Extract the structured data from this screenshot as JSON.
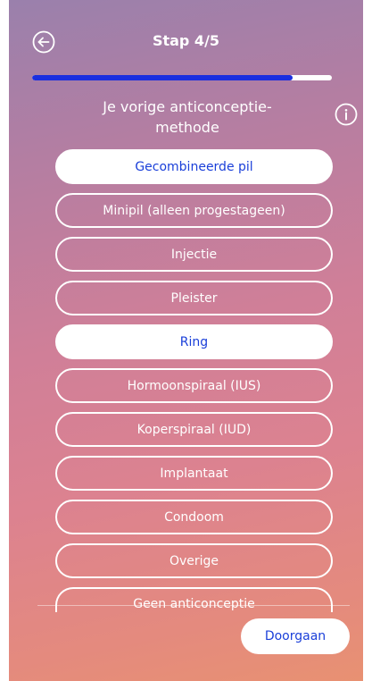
{
  "header": {
    "title": "Stap 4/5",
    "back_icon": "back-arrow-circle-icon"
  },
  "progress": {
    "fraction": 0.87,
    "fill_color": "#1a2ee0"
  },
  "question": {
    "text": "Je vorige anticonceptie-methode",
    "info_icon": "info-circle-icon"
  },
  "options": [
    {
      "label": "Gecombineerde pil",
      "selected": true
    },
    {
      "label": "Minipil (alleen progestageen)",
      "selected": false
    },
    {
      "label": "Injectie",
      "selected": false
    },
    {
      "label": "Pleister",
      "selected": false
    },
    {
      "label": "Ring",
      "selected": true
    },
    {
      "label": "Hormoonspiraal (IUS)",
      "selected": false
    },
    {
      "label": "Koperspiraal (IUD)",
      "selected": false
    },
    {
      "label": "Implantaat",
      "selected": false
    },
    {
      "label": "Condoom",
      "selected": false
    },
    {
      "label": "Overige",
      "selected": false
    },
    {
      "label": "Geen anticonceptie",
      "selected": false
    }
  ],
  "footer": {
    "continue_label": "Doorgaan"
  },
  "colors": {
    "accent": "#1a3fd9",
    "gradient_top": "#9a80ac",
    "gradient_bottom": "#e89172"
  }
}
